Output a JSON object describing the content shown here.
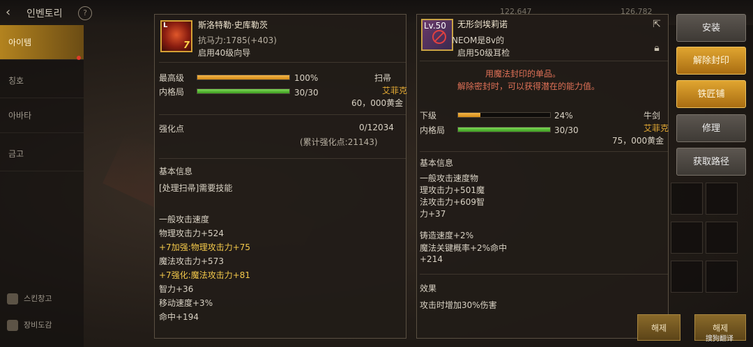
{
  "topbar": {
    "title": "인벤토리",
    "currency1": "122,647",
    "currency2": "126,782"
  },
  "leftnav": {
    "items": [
      "아이템",
      "칭호",
      "아바타",
      "금고"
    ],
    "bottom": [
      "스킨창고",
      "장비도감"
    ]
  },
  "left_panel": {
    "item_name": "斯洛特勒·史库勒茨",
    "item_level_badge": "L",
    "item_enhance_badge": "7",
    "resist_line": "抗马力:1785(+403)",
    "req_line": "启用40级向导",
    "grade_label": "最高级",
    "grade_pct": "100%",
    "grade_value": 1.0,
    "dur_label": "内格局",
    "dur_text": "30/30",
    "dur_value": 1.0,
    "type": "扫帚",
    "class": "艾菲克",
    "price": "60，000黄金",
    "enh_label": "强化点",
    "enh_value": "0/12034",
    "enh_total": "(累计强化点:21143)",
    "section_title": "基本信息",
    "skill_req": "[处理扫帚]需要技能",
    "stats": [
      {
        "text": "一般攻击速度",
        "hl": false
      },
      {
        "text": "物理攻击力+524",
        "hl": false
      },
      {
        "text": " +7加强:物理攻击力+75",
        "hl": true
      },
      {
        "text": "魔法攻击力+573",
        "hl": false
      },
      {
        "text": " +7强化:魔法攻击力+81",
        "hl": true
      },
      {
        "text": "智力+36",
        "hl": false
      },
      {
        "text": "移动速度+3%",
        "hl": false
      },
      {
        "text": "命中+194",
        "hl": false
      }
    ]
  },
  "right_panel": {
    "item_name": "无形剑埃莉诺",
    "item_level_badge": "Lv.50",
    "sub_line": "NEOM是8v的",
    "req_line": "启用50级耳检",
    "seal_msg1": "用魔法封印的单品。",
    "seal_msg2": "解除密封时，可以获得潜在的能力值。",
    "grade_label": "下级",
    "grade_pct": "24%",
    "grade_value": 0.24,
    "dur_label": "内格局",
    "dur_text": "30/30",
    "dur_value": 1.0,
    "type": "牛剑",
    "class": "艾菲克",
    "price": "75，000黄金",
    "section_title": "基本信息",
    "stats": [
      "一般攻击速度物",
      "理攻击力+501魔",
      "法攻击力+609智",
      "力+37"
    ],
    "stats2": [
      "铸造速度+2%",
      "魔法关键概率+2%命中",
      "+214"
    ],
    "effect_title": "效果",
    "effect_text": "攻击时增加30%伤害"
  },
  "actions": {
    "equip": "安装",
    "unseal": "解除封印",
    "smith": "铁匠铺",
    "repair": "修理",
    "source": "获取路径"
  },
  "bottom": {
    "btn1": "해제",
    "btn2": "해제"
  },
  "watermark": "搜狗翻译"
}
